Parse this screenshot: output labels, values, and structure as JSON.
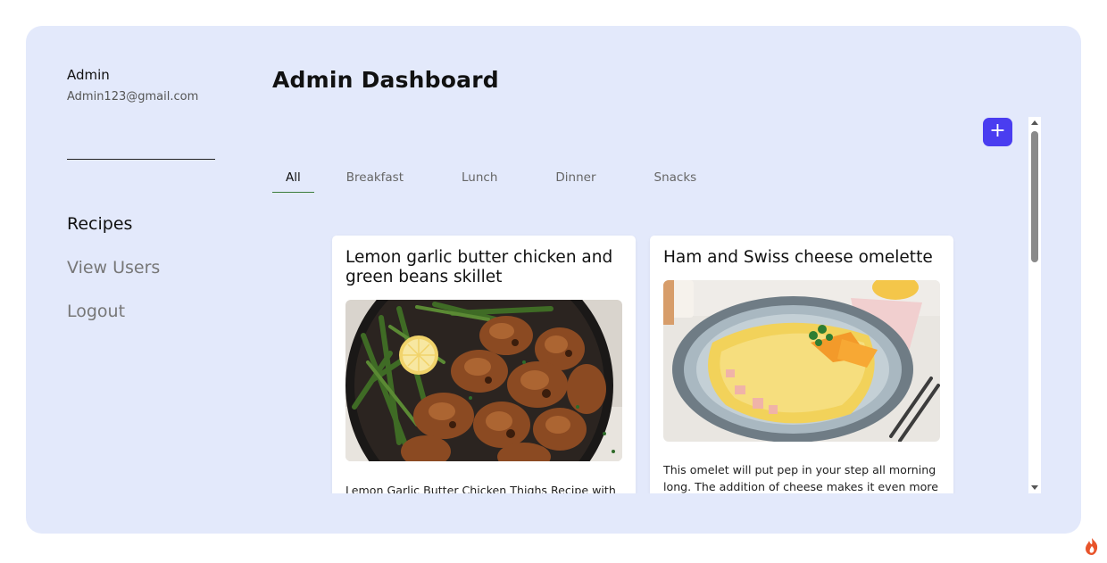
{
  "user": {
    "name": "Admin",
    "email": "Admin123@gmail.com"
  },
  "nav": {
    "items": [
      {
        "label": "Recipes",
        "active": true
      },
      {
        "label": "View Users",
        "active": false
      },
      {
        "label": "Logout",
        "active": false
      }
    ]
  },
  "header": {
    "title": "Admin Dashboard",
    "add_label": "+"
  },
  "tabs": [
    {
      "label": "All",
      "active": true
    },
    {
      "label": "Breakfast",
      "active": false
    },
    {
      "label": "Lunch",
      "active": false
    },
    {
      "label": "Dinner",
      "active": false
    },
    {
      "label": "Snacks",
      "active": false
    }
  ],
  "recipes": [
    {
      "title": "Lemon garlic butter chicken and green beans skillet",
      "image": "chicken-skillet-photo",
      "description": "Lemon Garlic Butter Chicken Thighs Recipe with green beans – a tasty one-pan meal."
    },
    {
      "title": "Ham and Swiss cheese omelette",
      "image": "omelette-photo",
      "description": "This omelet will put pep in your step all morning long. The addition of cheese makes it even more satisfying."
    }
  ],
  "colors": {
    "page_bg": "#ffffff",
    "panel_bg": "#e3e9fb",
    "accent": "#4a3df0",
    "tab_underline": "#3b7d3b"
  },
  "icons": {
    "add": "plus-icon",
    "corner": "flame-icon"
  }
}
